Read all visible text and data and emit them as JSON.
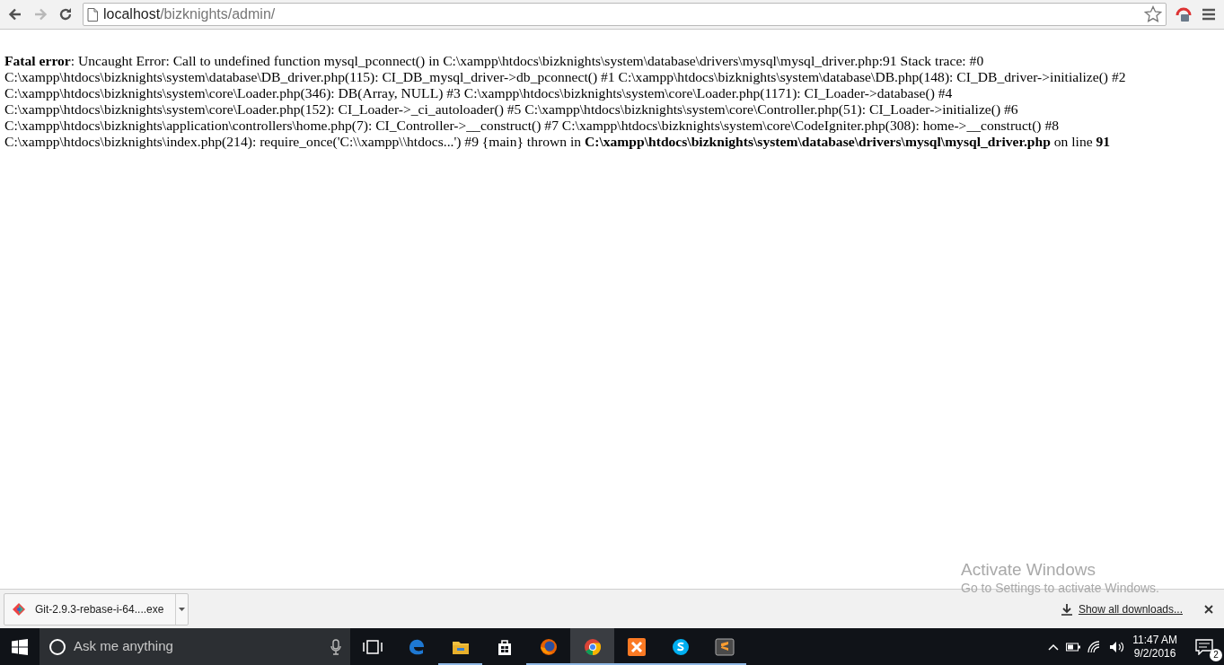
{
  "browser": {
    "back_disabled": false,
    "forward_disabled": true,
    "address": {
      "host": "localhost",
      "path": "/bizknights/admin/"
    }
  },
  "page": {
    "error_text": "**Fatal error**: Uncaught Error: Call to undefined function mysql_pconnect() in C:\\xampp\\htdocs\\bizknights\\system\\database\\drivers\\mysql\\mysql_driver.php:91 Stack trace: #0 C:\\xampp\\htdocs\\bizknights\\system\\database\\DB_driver.php(115): CI_DB_mysql_driver->db_pconnect() #1 C:\\xampp\\htdocs\\bizknights\\system\\database\\DB.php(148): CI_DB_driver->initialize() #2 C:\\xampp\\htdocs\\bizknights\\system\\core\\Loader.php(346): DB(Array, NULL) #3 C:\\xampp\\htdocs\\bizknights\\system\\core\\Loader.php(1171): CI_Loader->database() #4 C:\\xampp\\htdocs\\bizknights\\system\\core\\Loader.php(152): CI_Loader->_ci_autoloader() #5 C:\\xampp\\htdocs\\bizknights\\system\\core\\Controller.php(51): CI_Loader->initialize() #6 C:\\xampp\\htdocs\\bizknights\\application\\controllers\\home.php(7): CI_Controller->__construct() #7 C:\\xampp\\htdocs\\bizknights\\system\\core\\CodeIgniter.php(308): home->__construct() #8 C:\\xampp\\htdocs\\bizknights\\index.php(214): require_once('C:\\\\xampp\\\\htdocs...') #9 {main} thrown in **C:\\xampp\\htdocs\\bizknights\\system\\database\\drivers\\mysql\\mysql_driver.php** on line **91**"
  },
  "download_shelf": {
    "items": [
      {
        "filename": "Git-2.9.3-rebase-i-64....exe"
      }
    ],
    "show_all": "Show all downloads..."
  },
  "activation_notice": {
    "title": "Activate Windows",
    "subtitle": "Go to Settings to activate Windows."
  },
  "taskbar": {
    "search_placeholder": "Ask me anything",
    "apps": [
      {
        "kind": "edge",
        "running": false,
        "selected": false
      },
      {
        "kind": "explorer",
        "running": true,
        "selected": false
      },
      {
        "kind": "store",
        "running": false,
        "selected": false
      },
      {
        "kind": "firefox",
        "running": true,
        "selected": false
      },
      {
        "kind": "chrome",
        "running": true,
        "selected": true
      },
      {
        "kind": "xampp",
        "running": true,
        "selected": false
      },
      {
        "kind": "skype",
        "running": true,
        "selected": false
      },
      {
        "kind": "sublime",
        "running": true,
        "selected": false
      }
    ],
    "time": "11:47 AM",
    "date": "9/2/2016",
    "notifications": "2"
  }
}
